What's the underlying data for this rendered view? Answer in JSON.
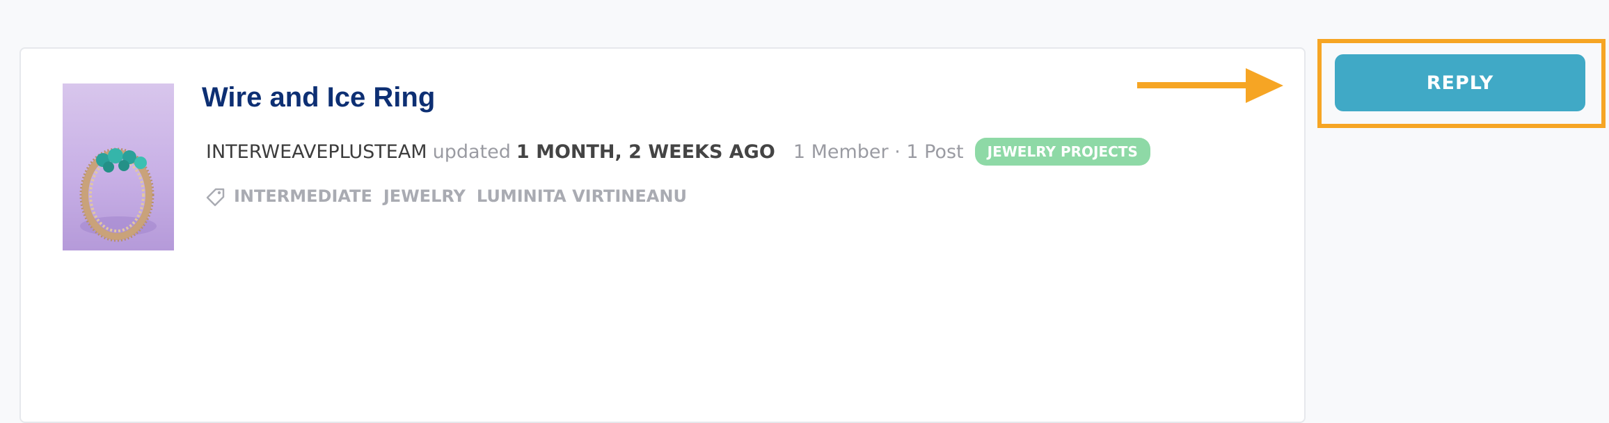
{
  "topic": {
    "title": "Wire and Ice Ring",
    "author": "INTERWEAVEPLUSTEAM",
    "updated_label": "updated",
    "updated_ago": "1 MONTH, 2 WEEKS AGO",
    "counts": "1 Member · 1 Post",
    "forum_badge": "JEWELRY PROJECTS",
    "tags": [
      "INTERMEDIATE",
      "JEWELRY",
      "LUMINITA VIRTINEANU"
    ]
  },
  "actions": {
    "reply_label": "REPLY"
  },
  "colors": {
    "title": "#0d2f73",
    "badge_bg": "#8ed9a6",
    "reply_bg": "#40a9c6",
    "highlight": "#f6a524"
  },
  "icons": {
    "tag": "tag-icon",
    "arrow": "arrow-right-icon"
  }
}
